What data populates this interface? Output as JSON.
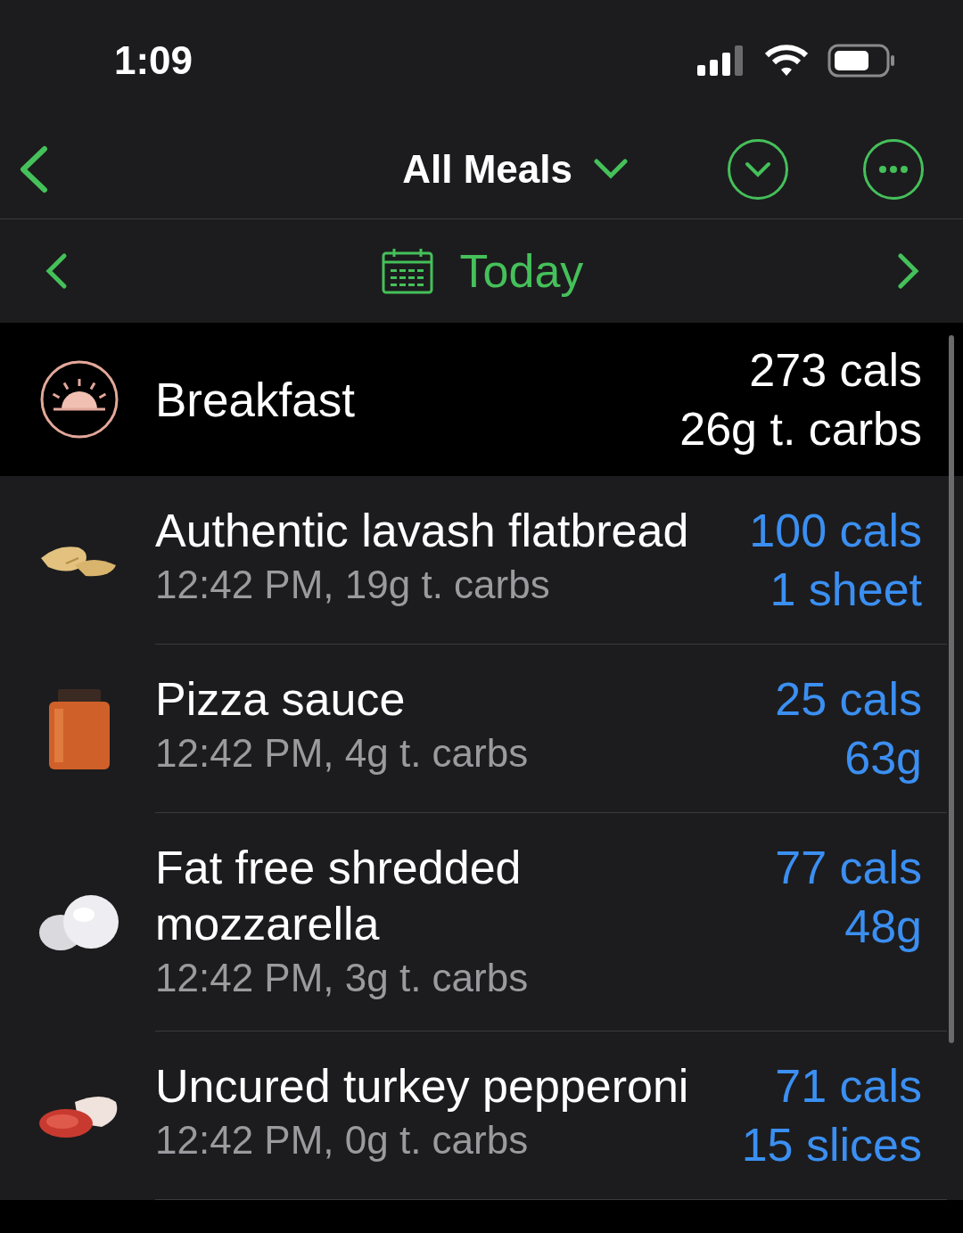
{
  "status_bar": {
    "time": "1:09"
  },
  "nav": {
    "title": "All Meals"
  },
  "date_bar": {
    "label": "Today"
  },
  "meal": {
    "name": "Breakfast",
    "calories": "273 cals",
    "carbs": "26g t. carbs"
  },
  "items": [
    {
      "kind": "flatbread",
      "name": "Authentic lavash flatbread",
      "detail": "12:42 PM, 19g t. carbs",
      "calories": "100 cals",
      "amount": "1 sheet"
    },
    {
      "kind": "jar",
      "name": "Pizza sauce",
      "detail": "12:42 PM, 4g t. carbs",
      "calories": "25 cals",
      "amount": "63g"
    },
    {
      "kind": "cheese",
      "name": "Fat free shredded mozzarella",
      "detail": "12:42 PM, 3g t. carbs",
      "calories": "77 cals",
      "amount": "48g"
    },
    {
      "kind": "pepperoni",
      "name": "Uncured turkey pepperoni",
      "detail": "12:42 PM, 0g t. carbs",
      "calories": "71 cals",
      "amount": "15 slices"
    }
  ]
}
